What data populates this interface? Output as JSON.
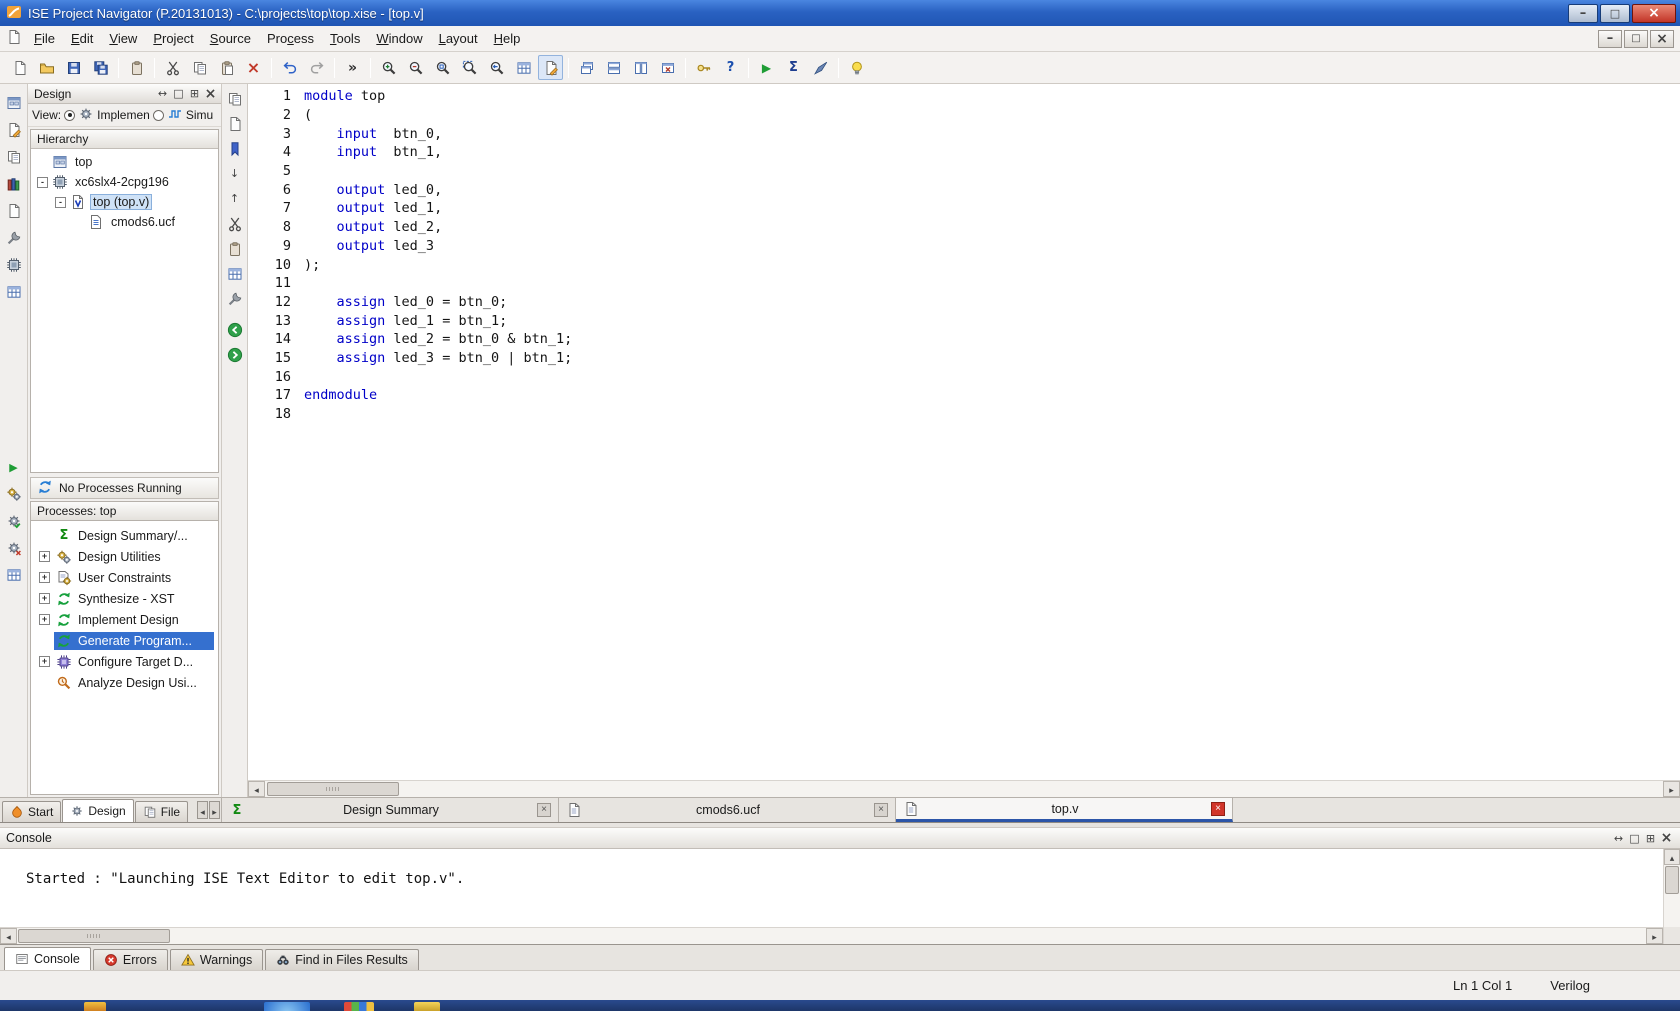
{
  "window": {
    "title": "ISE Project Navigator (P.20131013) - C:\\projects\\top\\top.xise - [top.v]",
    "controls": [
      "minimize-icon",
      "maximize-icon",
      "close-icon"
    ],
    "mdi_controls": [
      "minimize-icon",
      "restore-icon",
      "close-icon"
    ]
  },
  "menu": {
    "items": [
      {
        "label": "File",
        "accel": 0
      },
      {
        "label": "Edit",
        "accel": 0
      },
      {
        "label": "View",
        "accel": 0
      },
      {
        "label": "Project",
        "accel": 0
      },
      {
        "label": "Source",
        "accel": 0
      },
      {
        "label": "Process",
        "accel": 3
      },
      {
        "label": "Tools",
        "accel": 0
      },
      {
        "label": "Window",
        "accel": 0
      },
      {
        "label": "Layout",
        "accel": 0
      },
      {
        "label": "Help",
        "accel": 0
      }
    ]
  },
  "toolbar": {
    "active": "text-editor-icon",
    "icons": [
      "new-file-icon",
      "open-folder-icon",
      "save-icon",
      "save-all-icon",
      "|",
      "clipboard-icon",
      "|",
      "cut-icon",
      "copy-icon",
      "paste-icon",
      "delete-icon",
      "|",
      "undo-icon",
      "redo-icon",
      "|",
      "overflow-icon",
      "|",
      "zoom-in-icon",
      "zoom-out-icon",
      "zoom-full-icon",
      "zoom-region-icon",
      "zoom-prev-icon",
      "grid-icon",
      "text-editor-icon",
      "|",
      "cascade-icon",
      "tile-horizontal-icon",
      "tile-vertical-icon",
      "close-window-icon",
      "|",
      "key-icon",
      "whats-this-icon",
      "|",
      "run-icon",
      "sigma-icon",
      "launch-icon",
      "|",
      "lightbulb-icon"
    ]
  },
  "left_strip": {
    "top": [
      "window-icon",
      "page-edit-icon",
      "pages-icon",
      "books-icon",
      "new-file-icon",
      "wrench-icon",
      "chip-icon",
      "table-icon"
    ],
    "bottom": [
      "play-icon",
      "gears-icon",
      "gear-check-icon",
      "gear-x-icon",
      "table-icon"
    ]
  },
  "editor_strip": {
    "icons": [
      "pages-icon",
      "new-file-icon",
      "bookmark-icon",
      "arrow-down-icon",
      "arrow-up-icon",
      "cut-icon",
      "clipboard-icon",
      "grid-icon",
      "wrench-icon"
    ],
    "nav": [
      "nav-back-icon",
      "nav-forward-icon"
    ]
  },
  "design_panel": {
    "title": "Design",
    "header_buttons": [
      "float-icon",
      "maximize-icon",
      "dock-icon",
      "close-icon"
    ],
    "view_label": "View:",
    "view_options": [
      {
        "label": "Implemen"
      },
      {
        "label": "Simu"
      }
    ],
    "hierarchy_title": "Hierarchy",
    "tree": [
      {
        "label": "top",
        "icon": "project-icon",
        "level": 0
      },
      {
        "label": "xc6slx4-2cpg196",
        "icon": "device-icon",
        "level": 0,
        "expander": true
      },
      {
        "label": "top (top.v)",
        "icon": "verilog-file-icon",
        "level": 1,
        "expander": true,
        "selected": true
      },
      {
        "label": "cmods6.ucf",
        "icon": "ucf-file-icon",
        "level": 2
      }
    ],
    "no_processes": "No Processes Running",
    "processes_title": "Processes: top",
    "processes": [
      {
        "label": "Design Summary/...",
        "icon": "summary-icon"
      },
      {
        "label": "Design Utilities",
        "icon": "utilities-icon",
        "expand": true
      },
      {
        "label": "User Constraints",
        "icon": "constraints-icon",
        "expand": true
      },
      {
        "label": "Synthesize - XST",
        "icon": "process-icon",
        "expand": true
      },
      {
        "label": "Implement Design",
        "icon": "process-icon",
        "expand": true
      },
      {
        "label": "Generate Program...",
        "icon": "process-icon",
        "selected": true
      },
      {
        "label": "Configure Target D...",
        "icon": "target-device-icon",
        "expand": true
      },
      {
        "label": "Analyze Design Usi...",
        "icon": "analyze-icon"
      }
    ],
    "bottom_tabs": [
      {
        "label": "Start",
        "icon": "start-tab-icon"
      },
      {
        "label": "Design",
        "icon": "design-tab-icon",
        "active": true
      },
      {
        "label": "File",
        "icon": "files-tab-icon"
      }
    ]
  },
  "editor": {
    "tabs": [
      {
        "label": "Design Summary",
        "icon": "summary-icon"
      },
      {
        "label": "cmods6.ucf",
        "icon": "file-icon"
      },
      {
        "label": "top.v",
        "icon": "file-icon",
        "active": true
      }
    ],
    "code": [
      {
        "n": "1",
        "s": [
          [
            "k",
            "module"
          ],
          [
            "p",
            " top"
          ]
        ]
      },
      {
        "n": "2",
        "s": [
          [
            "p",
            "("
          ]
        ]
      },
      {
        "n": "3",
        "s": [
          [
            "p",
            "    "
          ],
          [
            "k",
            "input"
          ],
          [
            "p",
            "  btn_0,"
          ]
        ]
      },
      {
        "n": "4",
        "s": [
          [
            "p",
            "    "
          ],
          [
            "k",
            "input"
          ],
          [
            "p",
            "  btn_1,"
          ]
        ]
      },
      {
        "n": "5",
        "s": []
      },
      {
        "n": "6",
        "s": [
          [
            "p",
            "    "
          ],
          [
            "k",
            "output"
          ],
          [
            "p",
            " led_0,"
          ]
        ]
      },
      {
        "n": "7",
        "s": [
          [
            "p",
            "    "
          ],
          [
            "k",
            "output"
          ],
          [
            "p",
            " led_1,"
          ]
        ]
      },
      {
        "n": "8",
        "s": [
          [
            "p",
            "    "
          ],
          [
            "k",
            "output"
          ],
          [
            "p",
            " led_2,"
          ]
        ]
      },
      {
        "n": "9",
        "s": [
          [
            "p",
            "    "
          ],
          [
            "k",
            "output"
          ],
          [
            "p",
            " led_3"
          ]
        ]
      },
      {
        "n": "10",
        "s": [
          [
            "p",
            ");"
          ]
        ]
      },
      {
        "n": "11",
        "s": []
      },
      {
        "n": "12",
        "s": [
          [
            "p",
            "    "
          ],
          [
            "k",
            "assign"
          ],
          [
            "p",
            " led_0 = btn_0;"
          ]
        ]
      },
      {
        "n": "13",
        "s": [
          [
            "p",
            "    "
          ],
          [
            "k",
            "assign"
          ],
          [
            "p",
            " led_1 = btn_1;"
          ]
        ]
      },
      {
        "n": "14",
        "s": [
          [
            "p",
            "    "
          ],
          [
            "k",
            "assign"
          ],
          [
            "p",
            " led_2 = btn_0 & btn_1;"
          ]
        ]
      },
      {
        "n": "15",
        "s": [
          [
            "p",
            "    "
          ],
          [
            "k",
            "assign"
          ],
          [
            "p",
            " led_3 = btn_0 | btn_1;"
          ]
        ]
      },
      {
        "n": "16",
        "s": []
      },
      {
        "n": "17",
        "s": [
          [
            "k",
            "endmodule"
          ]
        ]
      },
      {
        "n": "18",
        "s": []
      }
    ]
  },
  "console": {
    "title": "Console",
    "header_buttons": [
      "float-icon",
      "maximize-icon",
      "dock-icon",
      "close-icon"
    ],
    "text": "Started : \"Launching ISE Text Editor to edit top.v\".",
    "tabs": [
      {
        "label": "Console",
        "icon": "console-icon",
        "active": true
      },
      {
        "label": "Errors",
        "icon": "error-icon"
      },
      {
        "label": "Warnings",
        "icon": "warning-icon"
      },
      {
        "label": "Find in Files Results",
        "icon": "find-icon"
      }
    ]
  },
  "status": {
    "line_col": "Ln 1 Col 1",
    "language": "Verilog"
  },
  "taskbar": {
    "items": [
      "taskbar-app-icon-1",
      "taskbar-app-icon-2",
      "taskbar-app-icon-3",
      "taskbar-app-icon-4"
    ]
  }
}
